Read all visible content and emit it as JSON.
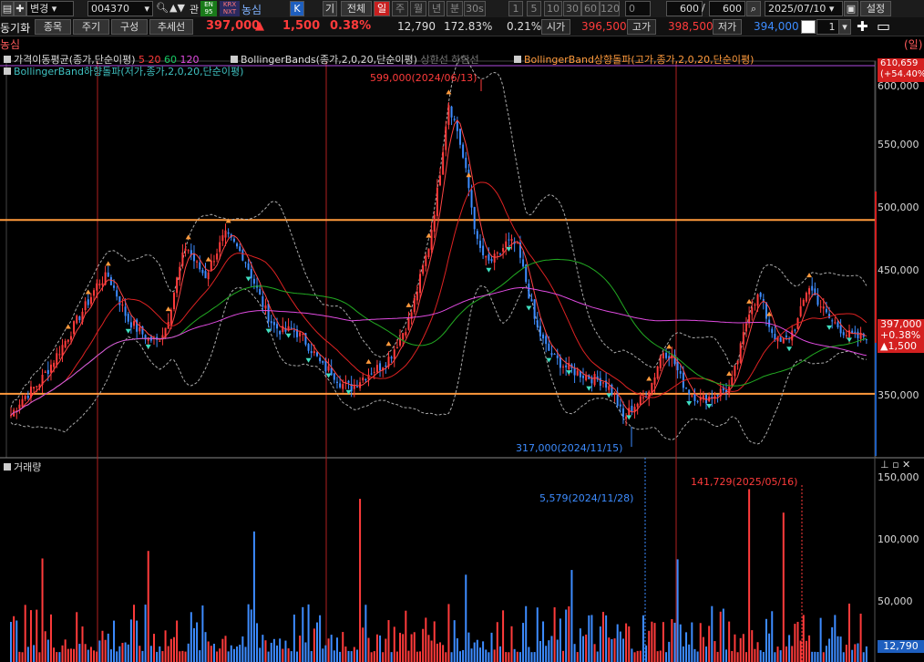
{
  "toolbar": {
    "mode_label": "변경",
    "code": "004370",
    "fav_label": "관",
    "badge_eng": "EN\n95",
    "badge_krx": "KRX\nNXT",
    "stock_name": "농심",
    "k_label": "K",
    "gi_label": "기",
    "all_label": "전체",
    "period_tabs": [
      "일",
      "주",
      "월",
      "년",
      "분",
      "30s"
    ],
    "interval_tabs": [
      "1",
      "5",
      "10",
      "30",
      "60",
      "120"
    ],
    "zero_label": "0",
    "count1": "600",
    "slash": "/",
    "count2": "600",
    "date": "2025/07/10",
    "settings_label": "설정"
  },
  "toolbar2": {
    "title_label": "동기화",
    "tabs": [
      "종목",
      "주기",
      "구성",
      "추세선"
    ],
    "price": "397,000",
    "change_arrow": "▲",
    "change": "1,500",
    "change_pct": "0.38%",
    "volume": "12,790",
    "vol_ratio": "172.83%",
    "turnover": "0.21%",
    "open_label": "시가",
    "open": "396,500",
    "high_label": "고가",
    "high": "398,500",
    "low_label": "저가",
    "low": "394,000",
    "spin_value": "1"
  },
  "chart_header": {
    "name": "농심",
    "period": "(일)",
    "ma_label": "가격이동평균(종가,단순이평)",
    "ma_periods": [
      "5",
      "20",
      "60",
      "120"
    ],
    "bb_label": "BollingerBands(종가,2,0,20,단순이평)",
    "bb_bands": "상한선 하한선",
    "bb_up_label": "BollingerBand상향돌파(고가,종가,2,0,20,단순이평)",
    "bb_down_label": "BollingerBand하향돌파(저가,종가,2,0,20,단순이평)"
  },
  "colors": {
    "ma5": "#ff3333",
    "ma20": "#22aa22",
    "ma60": "#ff33ff",
    "ma120": "#ff33ff",
    "up_candle": "#ff3b3b",
    "down_candle": "#3d8cff",
    "hline": "#ff9a3c",
    "bb": "#aaaaaa"
  },
  "annotations": {
    "high": "599,000(2024/06/13)",
    "low": "317,000(2024/11/15)",
    "vol_low": "5,579(2024/11/28)",
    "vol_high": "141,729(2025/05/16)"
  },
  "price_axis": {
    "top_label": "610,659",
    "top_pct": "(+54.40%)",
    "ticks": [
      "600,000",
      "550,000",
      "500,000",
      "450,000",
      "400,000",
      "350,000"
    ],
    "current": "397,000",
    "current_pct": "+0.38%",
    "current_change": "▲1,500"
  },
  "volume_panel": {
    "title": "거래량",
    "ticks": [
      "150,000",
      "100,000",
      "50,000"
    ],
    "current": "12,790"
  },
  "chart_data": {
    "type": "candlestick",
    "title": "농심",
    "price_range": [
      300000,
      610659
    ],
    "volume_range": [
      0,
      160000
    ],
    "horizontal_lines": [
      490000,
      350000
    ],
    "key_points": [
      {
        "label": "599,000(2024/06/13)",
        "value": 599000
      },
      {
        "label": "317,000(2024/11/15)",
        "value": 317000
      }
    ],
    "price_path": [
      333000,
      345000,
      352000,
      360000,
      372000,
      385000,
      398000,
      412000,
      425000,
      440000,
      445000,
      428000,
      410000,
      402000,
      395000,
      392000,
      405000,
      440000,
      470000,
      455000,
      445000,
      462000,
      478000,
      470000,
      460000,
      440000,
      420000,
      405000,
      400000,
      402000,
      395000,
      385000,
      372000,
      368000,
      358000,
      355000,
      362000,
      368000,
      372000,
      380000,
      395000,
      410000,
      440000,
      470000,
      520000,
      585000,
      560000,
      520000,
      470000,
      455000,
      460000,
      472000,
      470000,
      440000,
      405000,
      388000,
      378000,
      372000,
      368000,
      365000,
      362000,
      360000,
      350000,
      330000,
      340000,
      346000,
      360000,
      385000,
      380000,
      360000,
      350000,
      345000,
      348000,
      352000,
      355000,
      385000,
      420000,
      430000,
      405000,
      390000,
      395000,
      410000,
      438000,
      425000,
      412000,
      405000,
      398000,
      395000,
      397000
    ],
    "ma_periods": [
      5,
      20,
      60,
      120
    ],
    "volume_peaks": [
      150000,
      142000,
      141729,
      130000,
      129000
    ],
    "volume_last": 12790
  }
}
